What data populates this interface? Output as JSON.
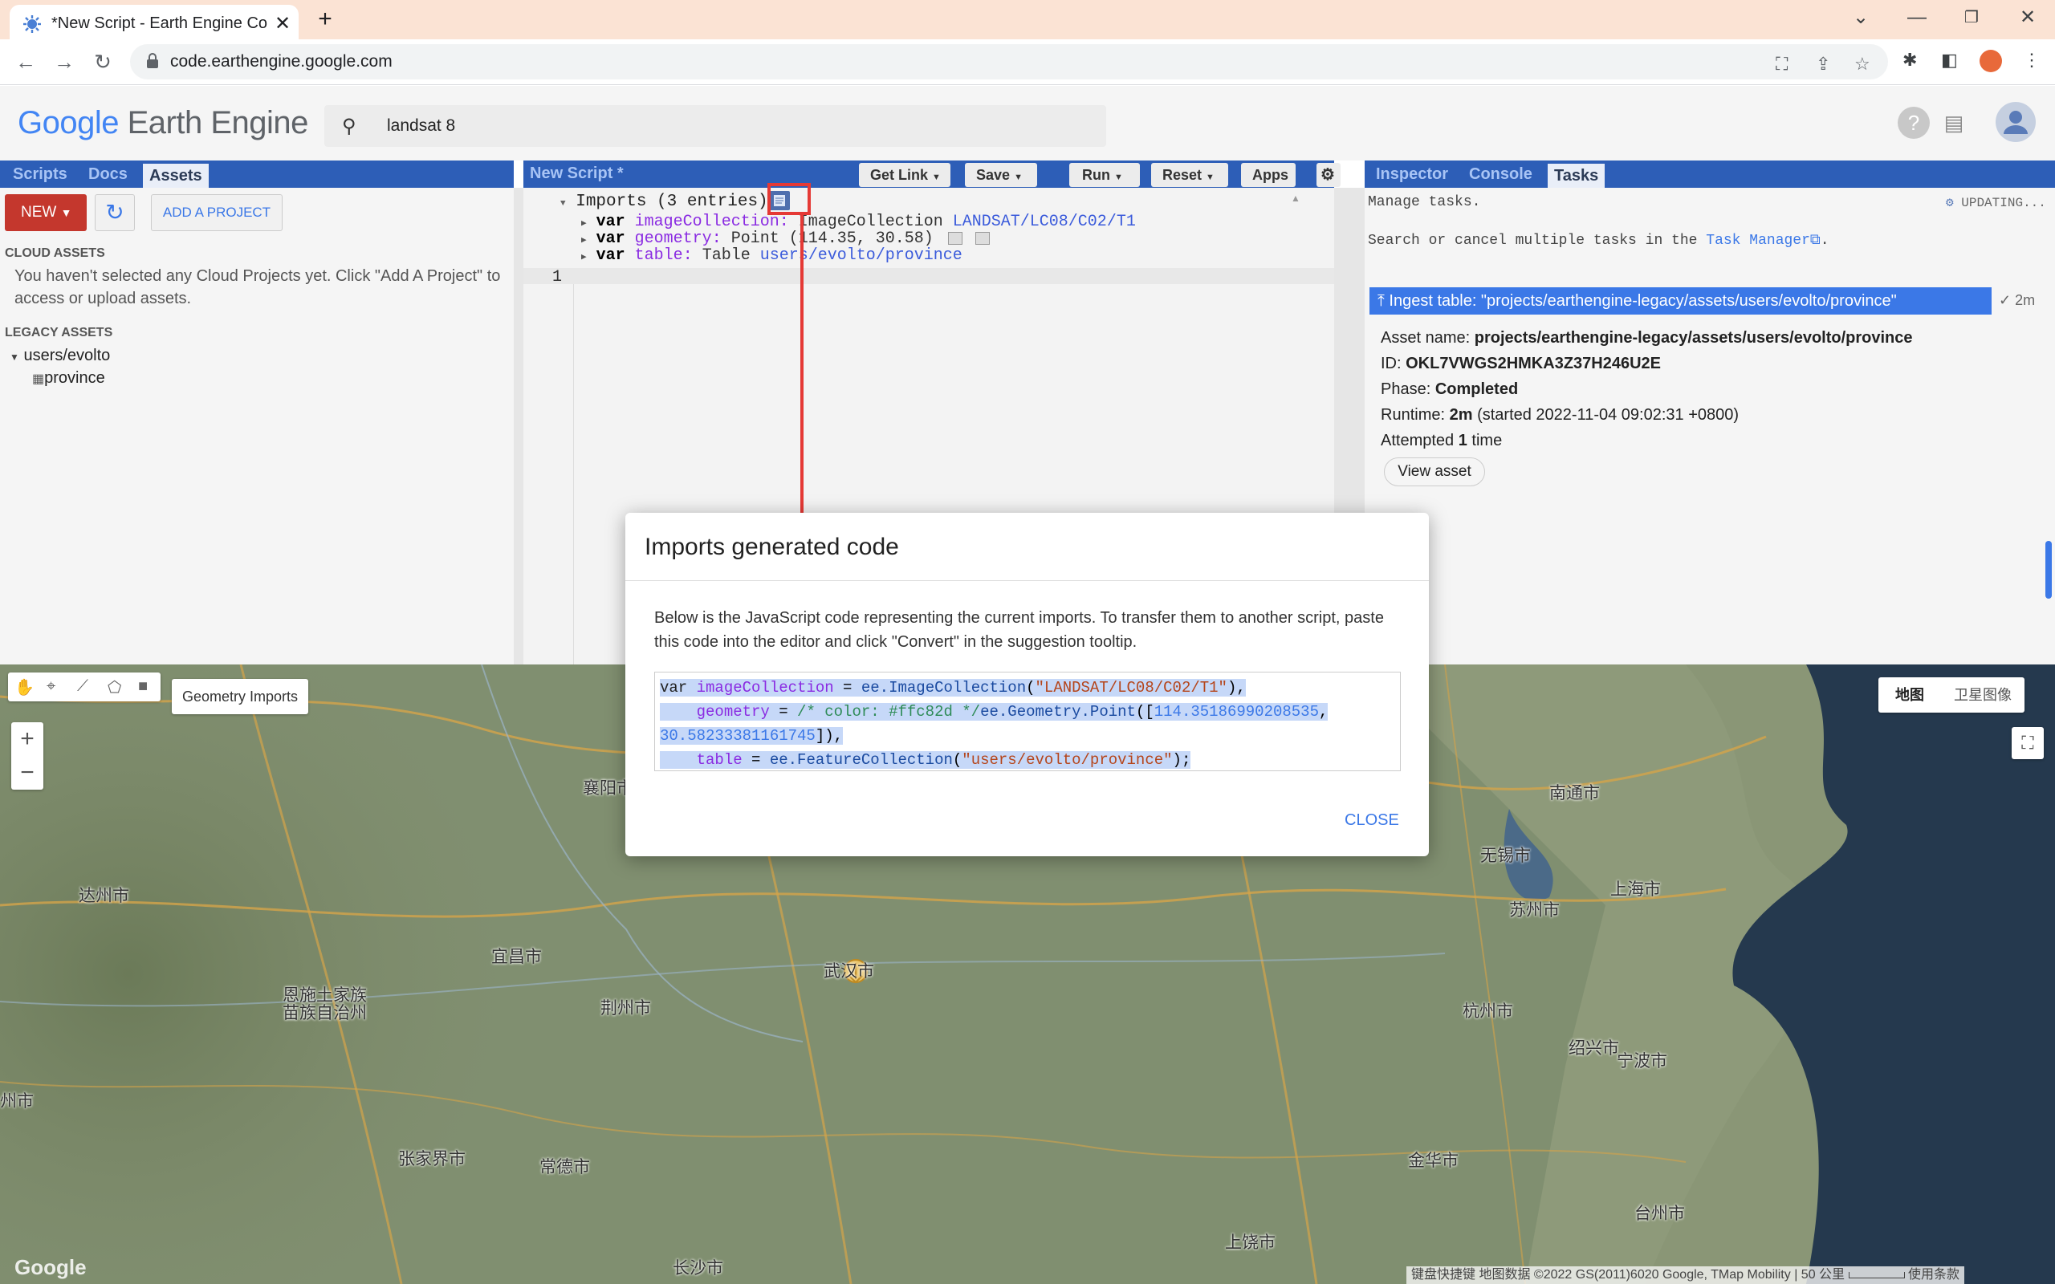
{
  "browser": {
    "tab_title": "*New Script - Earth Engine Co",
    "url": "code.earthengine.google.com"
  },
  "header": {
    "logo_google": "Google",
    "logo_product": "Earth Engine",
    "search_value": "landsat 8"
  },
  "left_panel": {
    "tabs": [
      "Scripts",
      "Docs",
      "Assets"
    ],
    "active_tab": "Assets",
    "new_label": "NEW",
    "add_project_label": "ADD A PROJECT",
    "cloud_assets_heading": "CLOUD ASSETS",
    "cloud_assets_message": "You haven't selected any Cloud Projects yet. Click \"Add A Project\" to access or upload assets.",
    "legacy_assets_heading": "LEGACY ASSETS",
    "tree_folder": "users/evolto",
    "tree_item": "province"
  },
  "editor": {
    "title": "New Script *",
    "buttons": [
      "Get Link",
      "Save",
      "Run",
      "Reset",
      "Apps"
    ],
    "imports_label": "Imports (3 entries)",
    "imports": [
      {
        "kw": "var",
        "name": "imageCollection",
        "sep": ":",
        "type": "ImageCollection",
        "value": "LANDSAT/LC08/C02/T1"
      },
      {
        "kw": "var",
        "name": "geometry",
        "sep": ":",
        "type": "Point",
        "value": "(114.35, 30.58)"
      },
      {
        "kw": "var",
        "name": "table",
        "sep": ":",
        "type": "Table",
        "value": "users/evolto/province"
      }
    ],
    "line_number": "1"
  },
  "right_panel": {
    "tabs": [
      "Inspector",
      "Console",
      "Tasks"
    ],
    "active_tab": "Tasks",
    "manage_tasks": "Manage tasks.",
    "updating": "UPDATING...",
    "search_cancel_prefix": "Search or cancel multiple tasks in the",
    "task_manager_link": "Task Manager",
    "task_title": "Ingest table: \"projects/earthengine-legacy/assets/users/evolto/province\"",
    "task_duration": "2m",
    "asset_name_label": "Asset name:",
    "asset_name_value": "projects/earthengine-legacy/assets/users/evolto/province",
    "id_label": "ID:",
    "id_value": "OKL7VWGS2HMKA3Z37H246U2E",
    "phase_label": "Phase:",
    "phase_value": "Completed",
    "runtime_label": "Runtime:",
    "runtime_value": "2m",
    "runtime_started": "(started 2022-11-04 09:02:31 +0800)",
    "attempted_prefix": "Attempted",
    "attempted_count": "1",
    "attempted_suffix": "time",
    "view_asset_label": "View asset"
  },
  "map": {
    "geometry_imports_label": "Geometry Imports",
    "map_type_map": "地图",
    "map_type_satellite": "卫星图像",
    "zoom_in": "+",
    "zoom_out": "−",
    "cities": [
      "襄阳市",
      "达州市",
      "宜昌市",
      "恩施土家族苗族自治州",
      "荆州市",
      "武汉市",
      "张家界市",
      "常德市",
      "长沙市",
      "上饶市",
      "南通市",
      "无锡市",
      "苏州市",
      "上海市",
      "杭州市",
      "绍兴市",
      "宁波市",
      "金华市",
      "台州市",
      "州市"
    ],
    "footer_google": "Google",
    "footer_shortcuts": "键盘快捷键",
    "footer_attribution": "地图数据 ©2022 GS(2011)6020 Google, TMap Mobility",
    "footer_scale": "50 公里",
    "footer_terms": "使用条款"
  },
  "dialog": {
    "title": "Imports generated code",
    "body": "Below is the JavaScript code representing the current imports. To transfer them to another script, paste this code into the editor and click \"Convert\" in the suggestion tooltip.",
    "code": {
      "l1_kw": "var",
      "l1_name": "imageCollection",
      "l1_eq": " = ",
      "l1_obj": "ee.ImageCollection",
      "l1_open": "(",
      "l1_str": "\"LANDSAT/LC08/C02/T1\"",
      "l1_close": "),",
      "l2_name": "geometry",
      "l2_eq": " = ",
      "l2_comment": "/* color: #ffc82d */",
      "l2_obj": "ee.Geometry.Point",
      "l2_open": "([",
      "l2_num1": "114.35186990208535",
      "l2_comma": ",",
      "l3_num2": "30.58233381161745",
      "l3_close": "]),",
      "l4_name": "table",
      "l4_eq": " = ",
      "l4_obj": "ee.FeatureCollection",
      "l4_open": "(",
      "l4_str": "\"users/evolto/province\"",
      "l4_close": ");"
    },
    "close_label": "CLOSE"
  },
  "colors": {
    "accent_blue": "#2d5eb7",
    "new_button_red": "#c4372d",
    "annotation_red": "#e53935",
    "task_highlight": "#3b78e7"
  }
}
